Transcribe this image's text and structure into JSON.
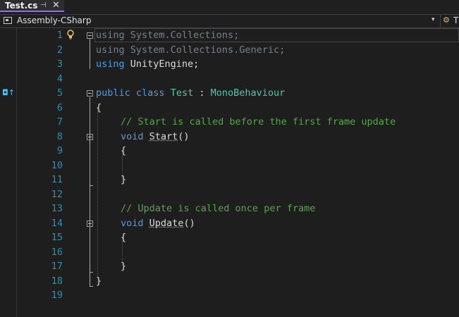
{
  "tab": {
    "title": "Test.cs",
    "pin_icon": "⊣",
    "close_icon": "✕"
  },
  "navbar": {
    "project": "Assembly-CSharp",
    "dropdown_icon": "▾",
    "member_icon": "⚙",
    "member_label": "T"
  },
  "gutter": {
    "lightbulb_icon": "lightbulb-icon",
    "codelens_icon": "◘↑"
  },
  "lines": [
    {
      "n": "1"
    },
    {
      "n": "2"
    },
    {
      "n": "3"
    },
    {
      "n": "4"
    },
    {
      "n": "5"
    },
    {
      "n": "6"
    },
    {
      "n": "7"
    },
    {
      "n": "8"
    },
    {
      "n": "9"
    },
    {
      "n": "10"
    },
    {
      "n": "11"
    },
    {
      "n": "12"
    },
    {
      "n": "13"
    },
    {
      "n": "14"
    },
    {
      "n": "15"
    },
    {
      "n": "16"
    },
    {
      "n": "17"
    },
    {
      "n": "18"
    },
    {
      "n": "19"
    }
  ],
  "code": {
    "l1_kw": "using",
    "l1_rest": " System.Collections;",
    "l2_kw": "using",
    "l2_rest": " System.Collections.Generic;",
    "l3_kw": "using",
    "l3_rest": " UnityEngine;",
    "l5_kw1": "public",
    "l5_kw2": "class",
    "l5_name": "Test",
    "l5_colon": " : ",
    "l5_base": "MonoBehaviour",
    "l6": "{",
    "l7": "// Start is called before the first frame update",
    "l8_kw": "void",
    "l8_name": "Start",
    "l8_rest": "()",
    "l9": "{",
    "l11": "}",
    "l13": "// Update is called once per frame",
    "l14_kw": "void",
    "l14_name": "Update",
    "l14_rest": "()",
    "l15": "{",
    "l17": "}",
    "l18": "}"
  },
  "colors": {
    "keyword": "#569cd6",
    "type": "#4ec9b0",
    "comment": "#57a64a",
    "line_number": "#2b91af",
    "tab_accent": "#9b6cf0"
  }
}
